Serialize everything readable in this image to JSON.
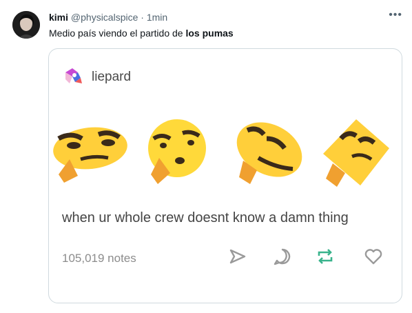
{
  "tweet": {
    "author_name": "kimi",
    "author_handle": "@physicalspice",
    "separator": "·",
    "time": "1min",
    "more_icon": "more-horizontal-icon",
    "text_prefix": "Medio país viendo el partido de ",
    "text_bold": "los pumas"
  },
  "embed": {
    "blog_name": "liepard",
    "caption": "when ur whole crew doesnt know a damn thing",
    "notes": "105,019 notes",
    "actions": [
      "share-icon",
      "reply-icon",
      "reblog-icon",
      "like-icon"
    ],
    "colors": {
      "reblog": "#39b38c",
      "icon_gray": "#9a9a9a",
      "emoji_yellow": "#ffcf3a"
    }
  }
}
